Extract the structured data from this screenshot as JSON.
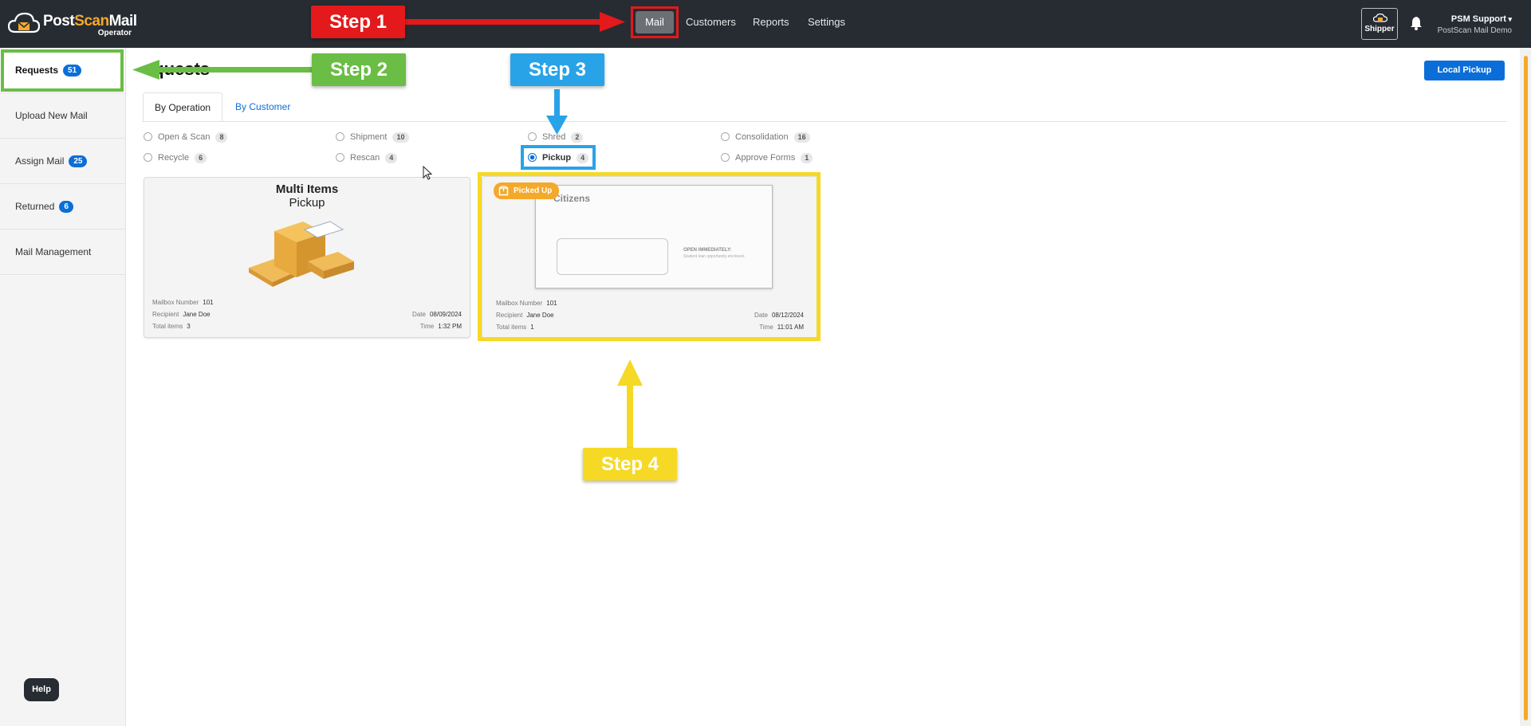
{
  "brand": {
    "name_part1": "Post",
    "name_part2": "Scan",
    "name_part3": "Mail",
    "subtitle": "Operator"
  },
  "topnav": {
    "items": [
      {
        "label": "Mail",
        "active": true
      },
      {
        "label": "Customers"
      },
      {
        "label": "Reports"
      },
      {
        "label": "Settings"
      }
    ]
  },
  "header": {
    "shipper_label": "Shipper",
    "user_name": "PSM Support",
    "user_sub": "PostScan Mail Demo"
  },
  "sidebar": {
    "items": [
      {
        "label": "Requests",
        "badge": "51",
        "active": true
      },
      {
        "label": "Upload New Mail"
      },
      {
        "label": "Assign Mail",
        "badge": "25"
      },
      {
        "label": "Returned",
        "badge": "6"
      },
      {
        "label": "Mail Management"
      }
    ]
  },
  "help_label": "Help",
  "page": {
    "title": "equests",
    "local_pickup_label": "Local Pickup"
  },
  "tabs": [
    {
      "label": "By Operation",
      "active": true
    },
    {
      "label": "By Customer"
    }
  ],
  "filters": [
    {
      "label": "Open & Scan",
      "count": "8"
    },
    {
      "label": "Shipment",
      "count": "10"
    },
    {
      "label": "Shred",
      "count": "2"
    },
    {
      "label": "Consolidation",
      "count": "16"
    },
    {
      "label": "Recycle",
      "count": "6"
    },
    {
      "label": "Rescan",
      "count": "4"
    },
    {
      "label": "Pickup",
      "count": "4",
      "checked": true
    },
    {
      "label": "Approve Forms",
      "count": "1"
    }
  ],
  "cards": [
    {
      "title": "Multi Items",
      "subtitle": "Pickup",
      "mailbox_label": "Mailbox Number",
      "mailbox": "101",
      "recipient_label": "Recipient",
      "recipient": "Jane Doe",
      "total_label": "Total items",
      "total": "3",
      "date_label": "Date",
      "date": "08/09/2024",
      "time_label": "Time",
      "time": "1:32 PM"
    },
    {
      "status": "Picked Up",
      "envelope_brand": "Citizens",
      "envelope_note": "OPEN IMMEDIATELY:",
      "envelope_note2": "Student loan opportunity enclosed.",
      "mailbox_label": "Mailbox Number",
      "mailbox": "101",
      "recipient_label": "Recipient",
      "recipient": "Jane Doe",
      "total_label": "Total items",
      "total": "1",
      "date_label": "Date",
      "date": "08/12/2024",
      "time_label": "Time",
      "time": "11:01 AM"
    }
  ],
  "annotations": {
    "step1": "Step 1",
    "step2": "Step 2",
    "step3": "Step 3",
    "step4": "Step 4"
  },
  "colors": {
    "topbar": "#272c33",
    "accent_blue": "#0b6ed8",
    "accent_orange": "#f4a92a",
    "step1": "#e3191b",
    "step2": "#6abd45",
    "step3": "#29a3e8",
    "step4": "#f6d925"
  }
}
